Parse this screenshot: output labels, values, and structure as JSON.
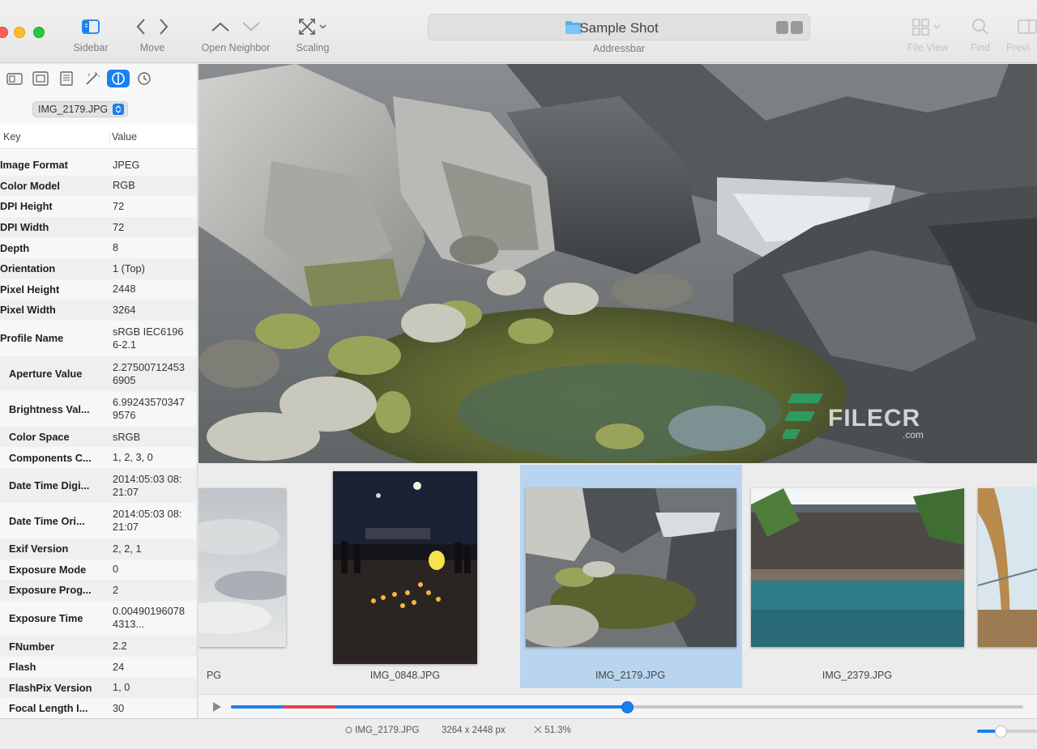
{
  "window": {
    "title": "Sample Shot"
  },
  "toolbar": {
    "sidebar_label": "Sidebar",
    "move_label": "Move",
    "neighbor_label": "Open Neighbor",
    "scaling_label": "Scaling",
    "address_label": "Addressbar",
    "fileview_label": "File View",
    "find_label": "Find",
    "preview_label": "Previ"
  },
  "inspector": {
    "tabs": [
      "file-info-icon",
      "image-info-icon",
      "document-icon",
      "adjust-icon",
      "exif-icon",
      "history-icon"
    ],
    "selected_file": "IMG_2179.JPG",
    "col_key": "Key",
    "col_value": "Value",
    "rows": [
      {
        "key": "Image Format",
        "value": "JPEG"
      },
      {
        "key": "Color Model",
        "value": "RGB"
      },
      {
        "key": "DPI Height",
        "value": "72"
      },
      {
        "key": "DPI Width",
        "value": "72"
      },
      {
        "key": "Depth",
        "value": "8"
      },
      {
        "key": "Orientation",
        "value": "1 (Top)"
      },
      {
        "key": "Pixel Height",
        "value": "2448"
      },
      {
        "key": "Pixel Width",
        "value": "3264"
      },
      {
        "key": "Profile Name",
        "value": "sRGB IEC61966-2.1"
      },
      {
        "key": "Aperture Value",
        "value": "2.275007124536905"
      },
      {
        "key": "Brightness Val...",
        "value": "6.992435703479576"
      },
      {
        "key": "Color Space",
        "value": "sRGB"
      },
      {
        "key": "Components C...",
        "value": "1, 2, 3, 0"
      },
      {
        "key": "Date Time Digi...",
        "value": "2014:05:03 08:21:07"
      },
      {
        "key": "Date Time Ori...",
        "value": "2014:05:03 08:21:07"
      },
      {
        "key": "Exif Version",
        "value": "2, 2, 1"
      },
      {
        "key": "Exposure Mode",
        "value": "0"
      },
      {
        "key": "Exposure Prog...",
        "value": "2"
      },
      {
        "key": "Exposure Time",
        "value": "0.004901960784313..."
      },
      {
        "key": "FNumber",
        "value": "2.2"
      },
      {
        "key": "Flash",
        "value": "24"
      },
      {
        "key": "FlashPix Version",
        "value": "1, 0"
      },
      {
        "key": "Focal Length I...",
        "value": "30"
      }
    ]
  },
  "filmstrip": {
    "items": [
      {
        "name": "PG"
      },
      {
        "name": "IMG_0848.JPG"
      },
      {
        "name": "IMG_2179.JPG",
        "selected": true
      },
      {
        "name": "IMG_2379.JPG"
      }
    ],
    "progress": 0.5
  },
  "statusbar": {
    "file": "IMG_2179.JPG",
    "dimensions": "3264 x 2448 px",
    "zoom": "51.3%"
  },
  "watermark": {
    "brand": "FILECR",
    "domain": ".com"
  },
  "colors": {
    "accent": "#1a7ff0",
    "selection": "#b9d4ef",
    "marker": "#e8414f"
  }
}
